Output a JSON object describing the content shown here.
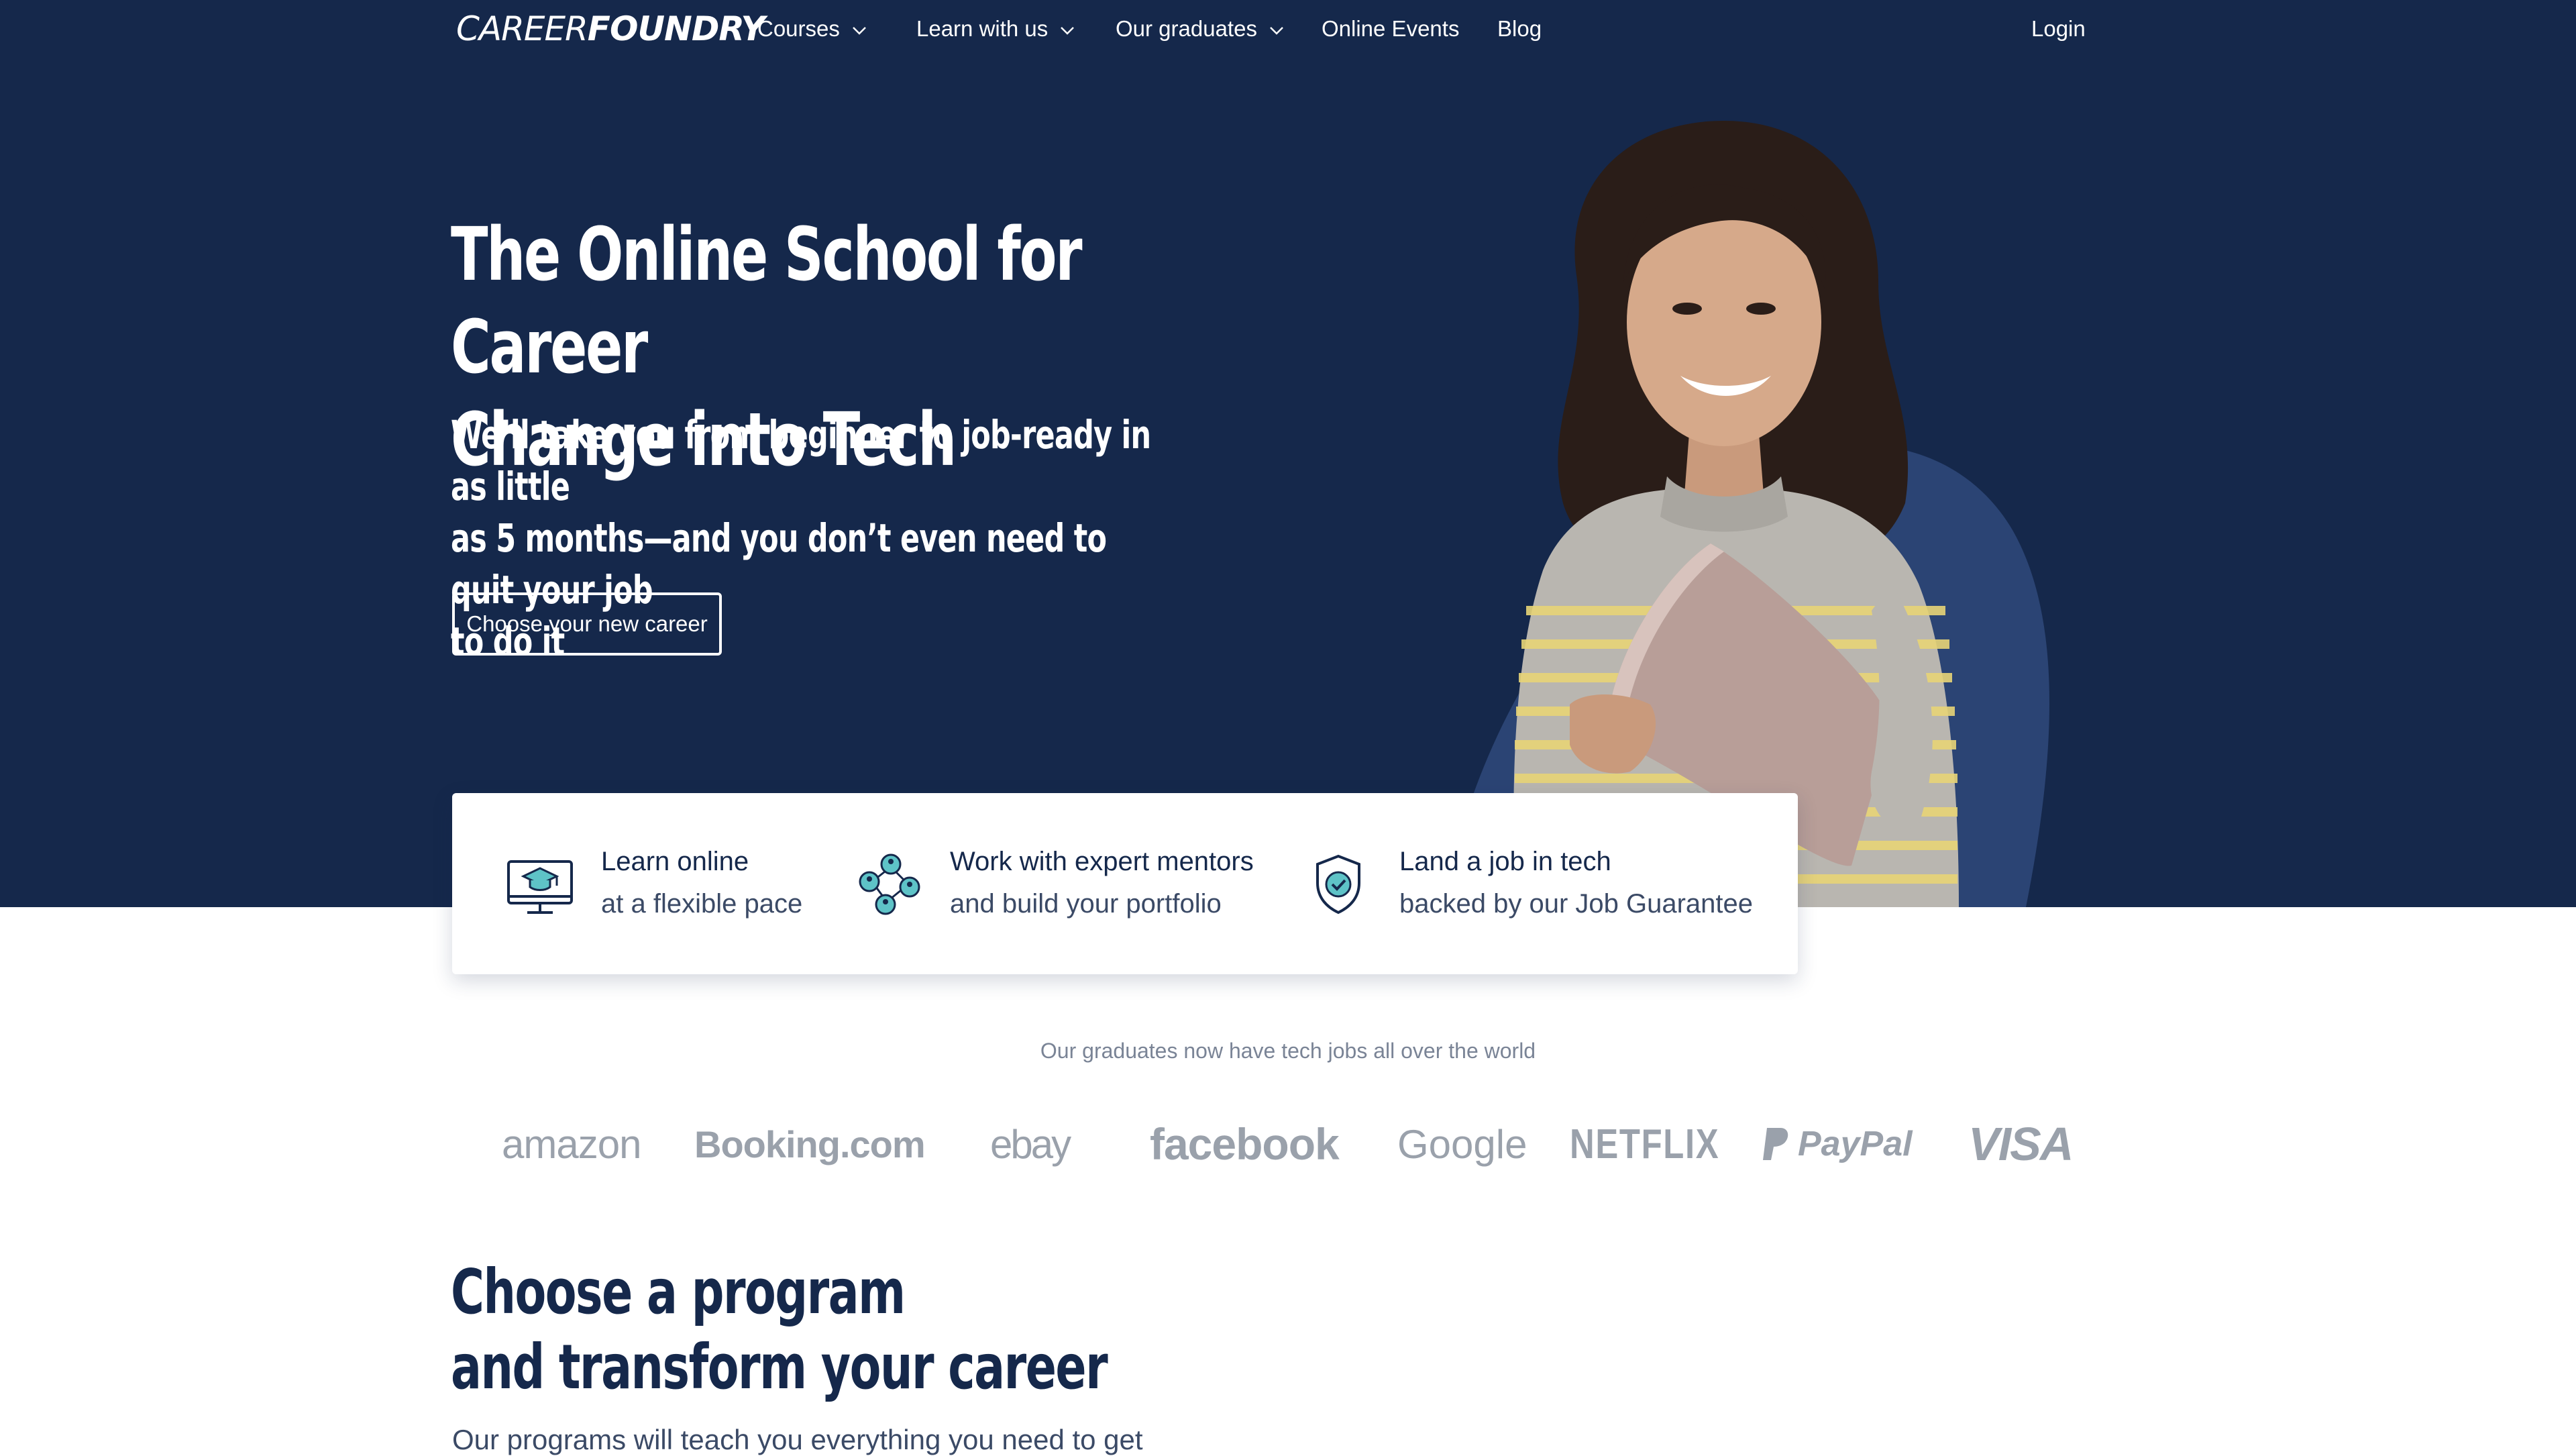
{
  "nav": {
    "logo_part1": "CAREER",
    "logo_part2": "FOUNDRY",
    "items": [
      {
        "label": "Courses",
        "has_dropdown": true
      },
      {
        "label": "Learn with us",
        "has_dropdown": true
      },
      {
        "label": "Our graduates",
        "has_dropdown": true
      },
      {
        "label": "Online Events",
        "has_dropdown": false
      },
      {
        "label": "Blog",
        "has_dropdown": false
      }
    ],
    "login": "Login"
  },
  "hero": {
    "title_line1": "The Online School for Career",
    "title_line2": "Change into Tech",
    "subtitle_line1": "We’ll take you from beginner to job-ready in as little",
    "subtitle_line2": "as 5 months—and you don’t even need to quit your job",
    "subtitle_line3": "to do it",
    "cta": "Choose your new career"
  },
  "features": [
    {
      "icon": "monitor-graduation-icon",
      "title": "Learn online",
      "description": "at a flexible pace"
    },
    {
      "icon": "mentors-network-icon",
      "title": "Work with expert mentors",
      "description": "and build your portfolio"
    },
    {
      "icon": "shield-check-icon",
      "title": "Land a job in tech",
      "description": "backed by our Job Guarantee"
    }
  ],
  "graduates": {
    "caption": "Our graduates now have tech jobs all over the world",
    "logos": [
      "amazon",
      "Booking.com",
      "ebay",
      "facebook",
      "Google",
      "NETFLIX",
      "PayPal",
      "VISA"
    ]
  },
  "program": {
    "title_line1": "Choose a program",
    "title_line2": "and transform your career",
    "subtitle": "Our programs will teach you everything you need to get"
  },
  "colors": {
    "hero_bg": "#15284b",
    "accent_blob": "#2b4474",
    "logo_grey": "#9aa1ab",
    "white": "#ffffff"
  }
}
